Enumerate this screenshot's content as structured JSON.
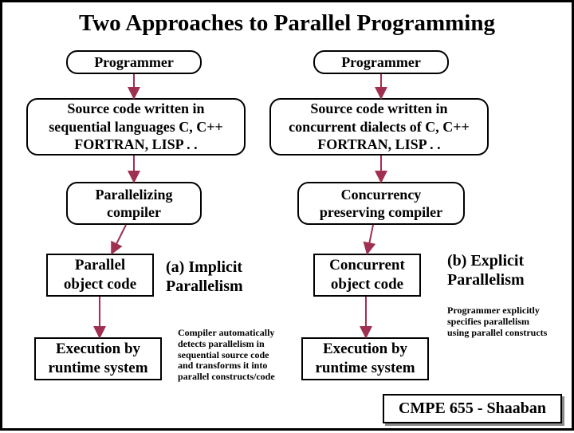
{
  "title": "Two Approaches to Parallel Programming",
  "left": {
    "programmer": "Programmer",
    "source": "Source code written in\nsequential languages  C, C++\nFORTRAN, LISP . .",
    "compiler": "Parallelizing\ncompiler",
    "object": "Parallel\nobject code",
    "exec": "Execution by\nruntime system"
  },
  "right": {
    "programmer": "Programmer",
    "source": "Source code written in\nconcurrent dialects of C, C++\nFORTRAN, LISP . .",
    "compiler": "Concurrency\npreserving compiler",
    "object": "Concurrent\nobject code",
    "exec": "Execution by\nruntime system"
  },
  "labels": {
    "a": "(a)  Implicit\n       Parallelism",
    "b": "(b) Explicit\n      Parallelism"
  },
  "notes": {
    "a": "Compiler automatically\ndetects parallelism in\nsequential source code\nand transforms it into\nparallel constructs/code",
    "b": "Programmer explicitly\nspecifies parallelism\nusing parallel constructs"
  },
  "footer": "CMPE 655 - Shaaban"
}
